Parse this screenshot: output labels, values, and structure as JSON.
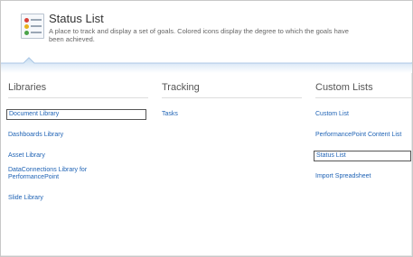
{
  "header": {
    "title": "Status List",
    "description": "A place to track and display a set of goals. Colored icons display the degree to which the goals have been achieved.",
    "icon": "status-list-icon"
  },
  "colors": {
    "link": "#1f63b5",
    "heading": "#555555",
    "band": "#dceaf7"
  },
  "columns": [
    {
      "heading": "Libraries",
      "items": [
        {
          "label": "Document Library",
          "selected": true
        },
        {
          "label": "Dashboards Library"
        },
        {
          "label": "Asset Library"
        },
        {
          "label": "DataConnections Library for PerformancePoint"
        },
        {
          "label": "Slide Library"
        }
      ]
    },
    {
      "heading": "Tracking",
      "items": [
        {
          "label": "Tasks"
        }
      ]
    },
    {
      "heading": "Custom Lists",
      "items": [
        {
          "label": "Custom List"
        },
        {
          "label": "PerformancePoint Content List"
        },
        {
          "label": "Status List",
          "selected": true
        },
        {
          "label": "Import Spreadsheet"
        }
      ]
    }
  ]
}
